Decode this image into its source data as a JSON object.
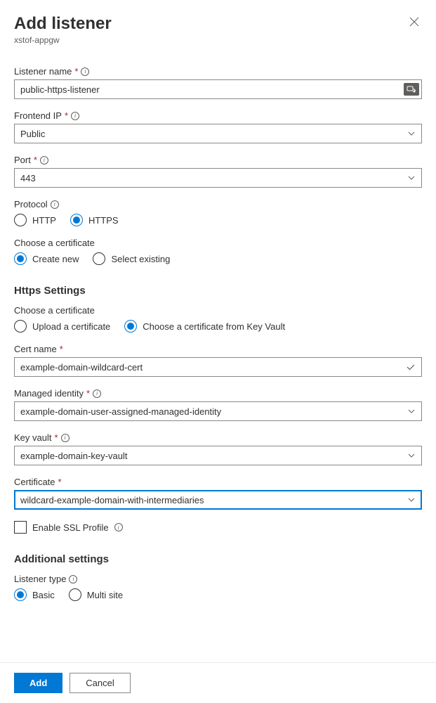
{
  "header": {
    "title": "Add listener",
    "subtitle": "xstof-appgw"
  },
  "listenerName": {
    "label": "Listener name",
    "value": "public-https-listener"
  },
  "frontendIp": {
    "label": "Frontend IP",
    "value": "Public"
  },
  "port": {
    "label": "Port",
    "value": "443"
  },
  "protocol": {
    "label": "Protocol",
    "options": {
      "http": "HTTP",
      "https": "HTTPS"
    }
  },
  "chooseCert1": {
    "label": "Choose a certificate",
    "options": {
      "create": "Create new",
      "select": "Select existing"
    }
  },
  "httpsSettings": {
    "heading": "Https Settings"
  },
  "chooseCert2": {
    "label": "Choose a certificate",
    "options": {
      "upload": "Upload a certificate",
      "keyvault": "Choose a certificate from Key Vault"
    }
  },
  "certName": {
    "label": "Cert name",
    "value": "example-domain-wildcard-cert"
  },
  "managedIdentity": {
    "label": "Managed identity",
    "value": "example-domain-user-assigned-managed-identity"
  },
  "keyVault": {
    "label": "Key vault",
    "value": "example-domain-key-vault"
  },
  "certificate": {
    "label": "Certificate",
    "value": "wildcard-example-domain-with-intermediaries"
  },
  "enableSsl": {
    "label": "Enable SSL Profile"
  },
  "additionalSettings": {
    "heading": "Additional settings"
  },
  "listenerType": {
    "label": "Listener type",
    "options": {
      "basic": "Basic",
      "multi": "Multi site"
    }
  },
  "footer": {
    "add": "Add",
    "cancel": "Cancel"
  }
}
